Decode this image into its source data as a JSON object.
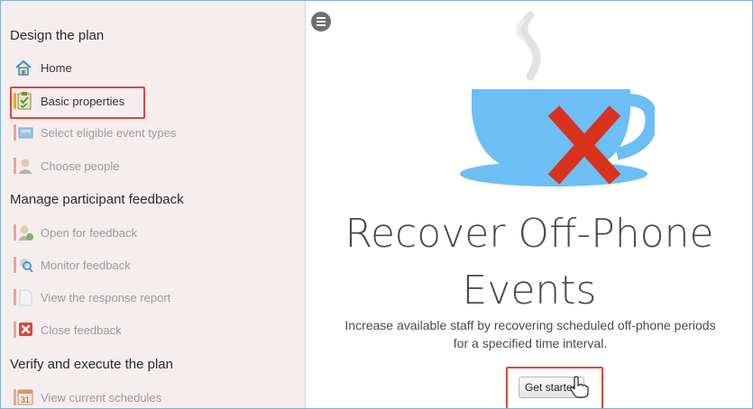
{
  "sidebar": {
    "sections": [
      {
        "title": "Design the plan",
        "items": [
          {
            "label": "Home",
            "icon": "home-icon"
          },
          {
            "label": "Basic properties",
            "icon": "checklist-icon"
          },
          {
            "label": "Select eligible event types",
            "icon": "event-types-icon"
          },
          {
            "label": "Choose people",
            "icon": "person-icon"
          }
        ]
      },
      {
        "title": "Manage participant feedback",
        "items": [
          {
            "label": "Open for feedback",
            "icon": "person-feedback-icon"
          },
          {
            "label": "Monitor feedback",
            "icon": "monitor-search-icon"
          },
          {
            "label": "View the response report",
            "icon": "document-icon"
          },
          {
            "label": "Close feedback",
            "icon": "close-x-icon"
          }
        ]
      },
      {
        "title": "Verify and execute the plan",
        "items": [
          {
            "label": "View current schedules",
            "icon": "calendar-icon"
          }
        ]
      }
    ],
    "calendar_day": "31"
  },
  "main": {
    "title_line1": "Recover Off-Phone",
    "title_line2": "Events",
    "description_line1": "Increase available staff by recovering scheduled off-phone periods",
    "description_line2": "for a specified time interval.",
    "cta_label": "Get started"
  },
  "colors": {
    "highlight": "#e0463b",
    "cup": "#6cbef5",
    "x_mark": "#d9321f",
    "sidebar_bg": "#f6eeee"
  }
}
